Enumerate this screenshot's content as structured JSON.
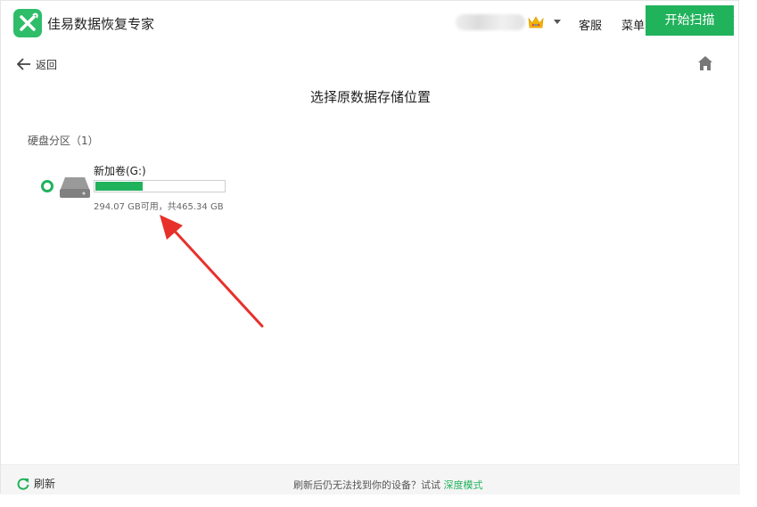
{
  "app": {
    "title": "佳易数据恢复专家",
    "accent_color": "#21b25c"
  },
  "titlebar": {
    "user_icon": "crown-icon",
    "service_label": "客服",
    "menu_label": "菜单"
  },
  "nav": {
    "back_label": "返回",
    "home_icon": "home-icon"
  },
  "page": {
    "title": "选择原数据存储位置",
    "section_label": "硬盘分区（1）"
  },
  "drives": [
    {
      "name": "新加卷(G:)",
      "selected": true,
      "usage_fraction": 0.368,
      "size_text": "294.07 GB可用，共465.34 GB"
    }
  ],
  "footer": {
    "refresh_label": "刷新",
    "hint_text": "刷新后仍无法找到你的设备？试试",
    "deep_mode_label": "深度模式",
    "scan_button_label": "开始扫描"
  }
}
